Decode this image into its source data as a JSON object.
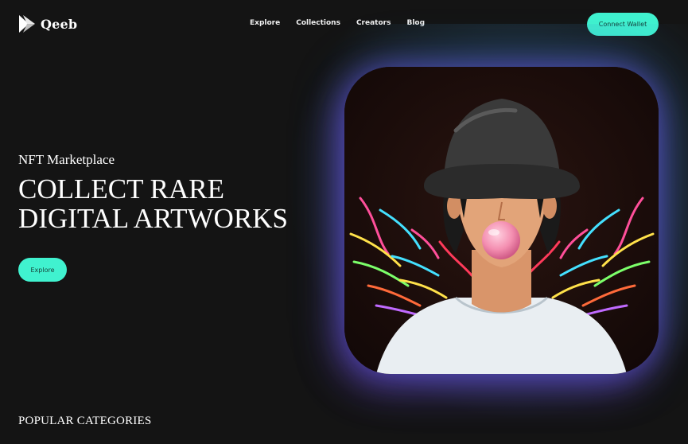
{
  "brand": {
    "name": "Qeeb",
    "logo_icon": "qeeb-logo-icon",
    "accent_color": "#40f2cf"
  },
  "nav": {
    "items": [
      {
        "label": "Explore"
      },
      {
        "label": "Collections"
      },
      {
        "label": "Creators"
      },
      {
        "label": "Blog"
      }
    ]
  },
  "header": {
    "connect_wallet_label": "Connect Wallet"
  },
  "hero": {
    "eyebrow": "NFT Marketplace",
    "headline_line1": "COLLECT RARE",
    "headline_line2": "DIGITAL ARTWORKS",
    "explore_label": "Explore",
    "artwork": "bubblegum-bucket-hat-character-with-neon-wings"
  },
  "sections": {
    "popular_categories_title": "POPULAR CATEGORIES"
  }
}
